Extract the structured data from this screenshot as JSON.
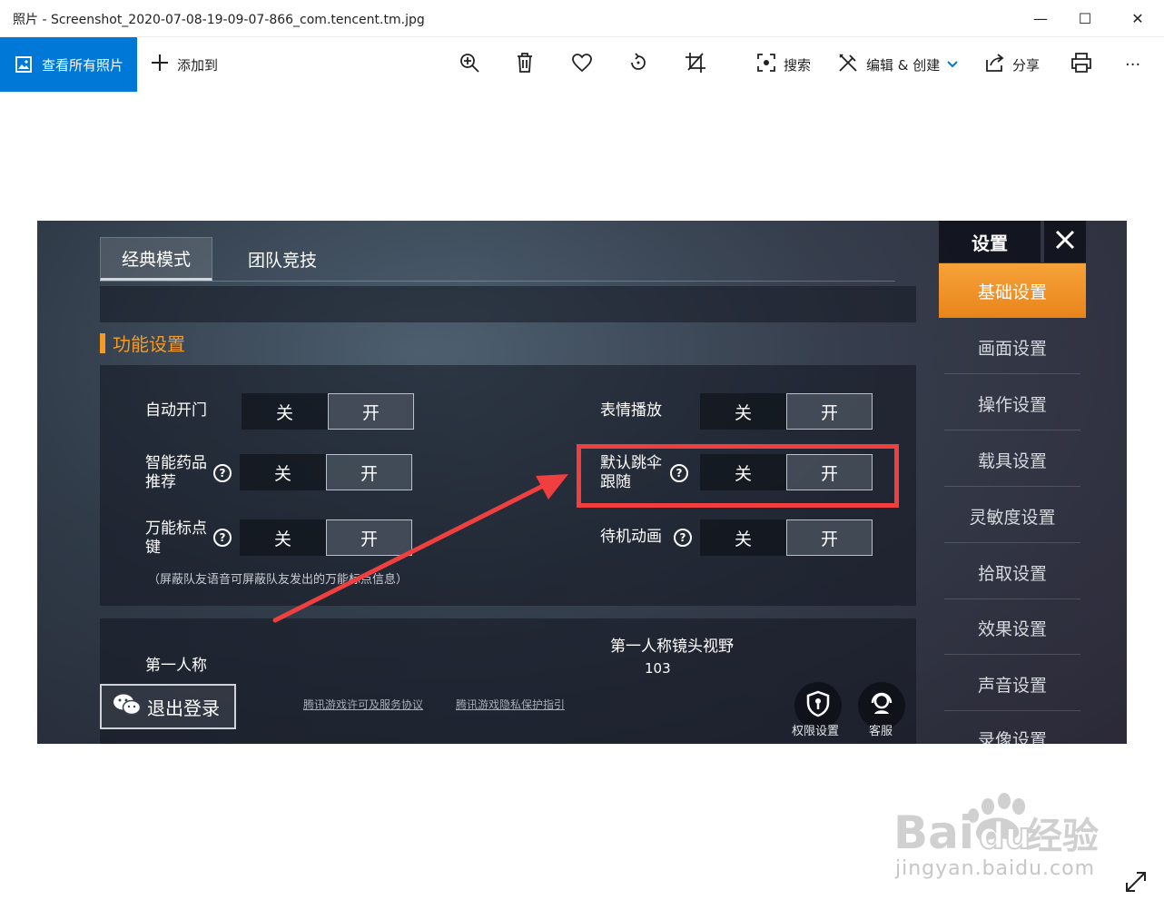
{
  "window": {
    "title": "照片 - Screenshot_2020-07-08-19-09-07-866_com.tencent.tm.jpg",
    "minimize_glyph": "—",
    "maximize_glyph": "☐",
    "close_glyph": "✕"
  },
  "toolbar": {
    "all_photos": "查看所有照片",
    "add_to": "添加到",
    "search": "搜索",
    "edit_create": "编辑 & 创建",
    "share": "分享",
    "more": "···"
  },
  "game": {
    "tabs": [
      "经典模式",
      "团队竞技"
    ],
    "section_title": "功能设置",
    "off_label": "关",
    "on_label": "开",
    "help_glyph": "?",
    "settings_left": [
      "自动开门",
      "智能药品推荐",
      "万能标点键"
    ],
    "settings_right": [
      "表情播放",
      "默认跳伞跟随",
      "待机动画"
    ],
    "note": "（屏蔽队友语音可屏蔽队友发出的万能标点信息）",
    "first_person_label": "第一人称",
    "fov_label": "第一人称镜头视野",
    "fov_value": "103",
    "sidebar_title": "设置",
    "sidebar_items": [
      "基础设置",
      "画面设置",
      "操作设置",
      "载具设置",
      "灵敏度设置",
      "拾取设置",
      "效果设置",
      "声音设置",
      "录像设置"
    ],
    "logout": "退出登录",
    "link_license": "腾讯游戏许可及服务协议",
    "link_privacy": "腾讯游戏隐私保护指引",
    "permission": "权限设置",
    "support": "客服"
  },
  "watermark": {
    "brand": "Bai",
    "brand2": "du",
    "brand3": "经验",
    "url": "jingyan.baidu.com"
  },
  "colors": {
    "accent_blue": "#0078d7",
    "orange": "#f59a23",
    "highlight_red": "#ef3f3f"
  }
}
